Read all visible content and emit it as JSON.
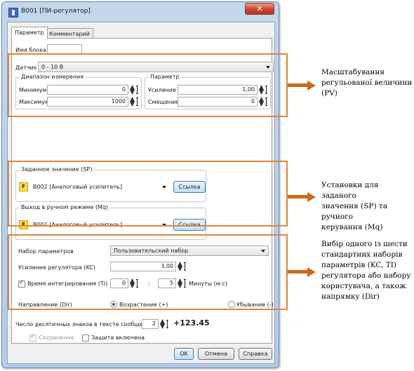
{
  "window": {
    "title": "B001 [ПИ-регулятор]",
    "close_glyph": "✕"
  },
  "tabs": [
    {
      "label": "Параметр"
    },
    {
      "label": "Комментарий"
    }
  ],
  "block_name": {
    "label": "Имя блока",
    "value": ""
  },
  "sensor": {
    "label": "Датчик",
    "value": "0 - 10 В"
  },
  "range_group": {
    "title": "Диапазон измерения",
    "min_label": "Минимум",
    "min_value": "0",
    "max_label": "Максимум",
    "max_value": "1000"
  },
  "param_group": {
    "title": "Параметр",
    "gain_label": "Усиление",
    "gain_value": "1,00",
    "offset_label": "Смещение",
    "offset_value": "0"
  },
  "setpoint": {
    "title": "Заданное значение (SP)",
    "value": "B002 [Аналоговый усилитель]",
    "link_label": "Ссылка"
  },
  "manual": {
    "title": "Выход в ручном режиме (Mq)",
    "value": "B002 [Аналоговый усилитель]",
    "link_label": "Ссылка"
  },
  "param_set": {
    "label": "Набор параметров",
    "value": "Пользовательский набор"
  },
  "kc": {
    "label": "Усиление регулятора (KC)",
    "value": "3,00"
  },
  "ti": {
    "label": "Время интегрирования (TI)",
    "checked": true,
    "minutes": "0",
    "separator": ":",
    "seconds": "5",
    "unit": "Минуты (м:с)"
  },
  "direction": {
    "label": "Направление (Dir)",
    "up_label": "Возрастание (+)",
    "down_label": "Убывание (-)",
    "selected": "up"
  },
  "decimals": {
    "label": "Число десятичных знаков в тексте сообщения",
    "value": "2",
    "preview": "+123.45"
  },
  "options": {
    "save_label": "Сохранение",
    "save_checked": true,
    "protect_label": "Защита включена",
    "protect_checked": false
  },
  "buttons": {
    "ok": "OK",
    "cancel": "Отмена",
    "help": "Справка"
  },
  "annotations": {
    "color": "#e0873a",
    "pv": [
      "Масштабування",
      "регульованої величини",
      "(PV)"
    ],
    "sp": [
      "Установки для заданого",
      "значення (SP) та ручного",
      "керування (Mq)"
    ],
    "kc": [
      "Вибір одного із шести",
      "стандартних наборів",
      "параметрів (KC, TI)",
      "регулятора або набору",
      "користувача, а також",
      "напрямку (Dir)"
    ]
  }
}
